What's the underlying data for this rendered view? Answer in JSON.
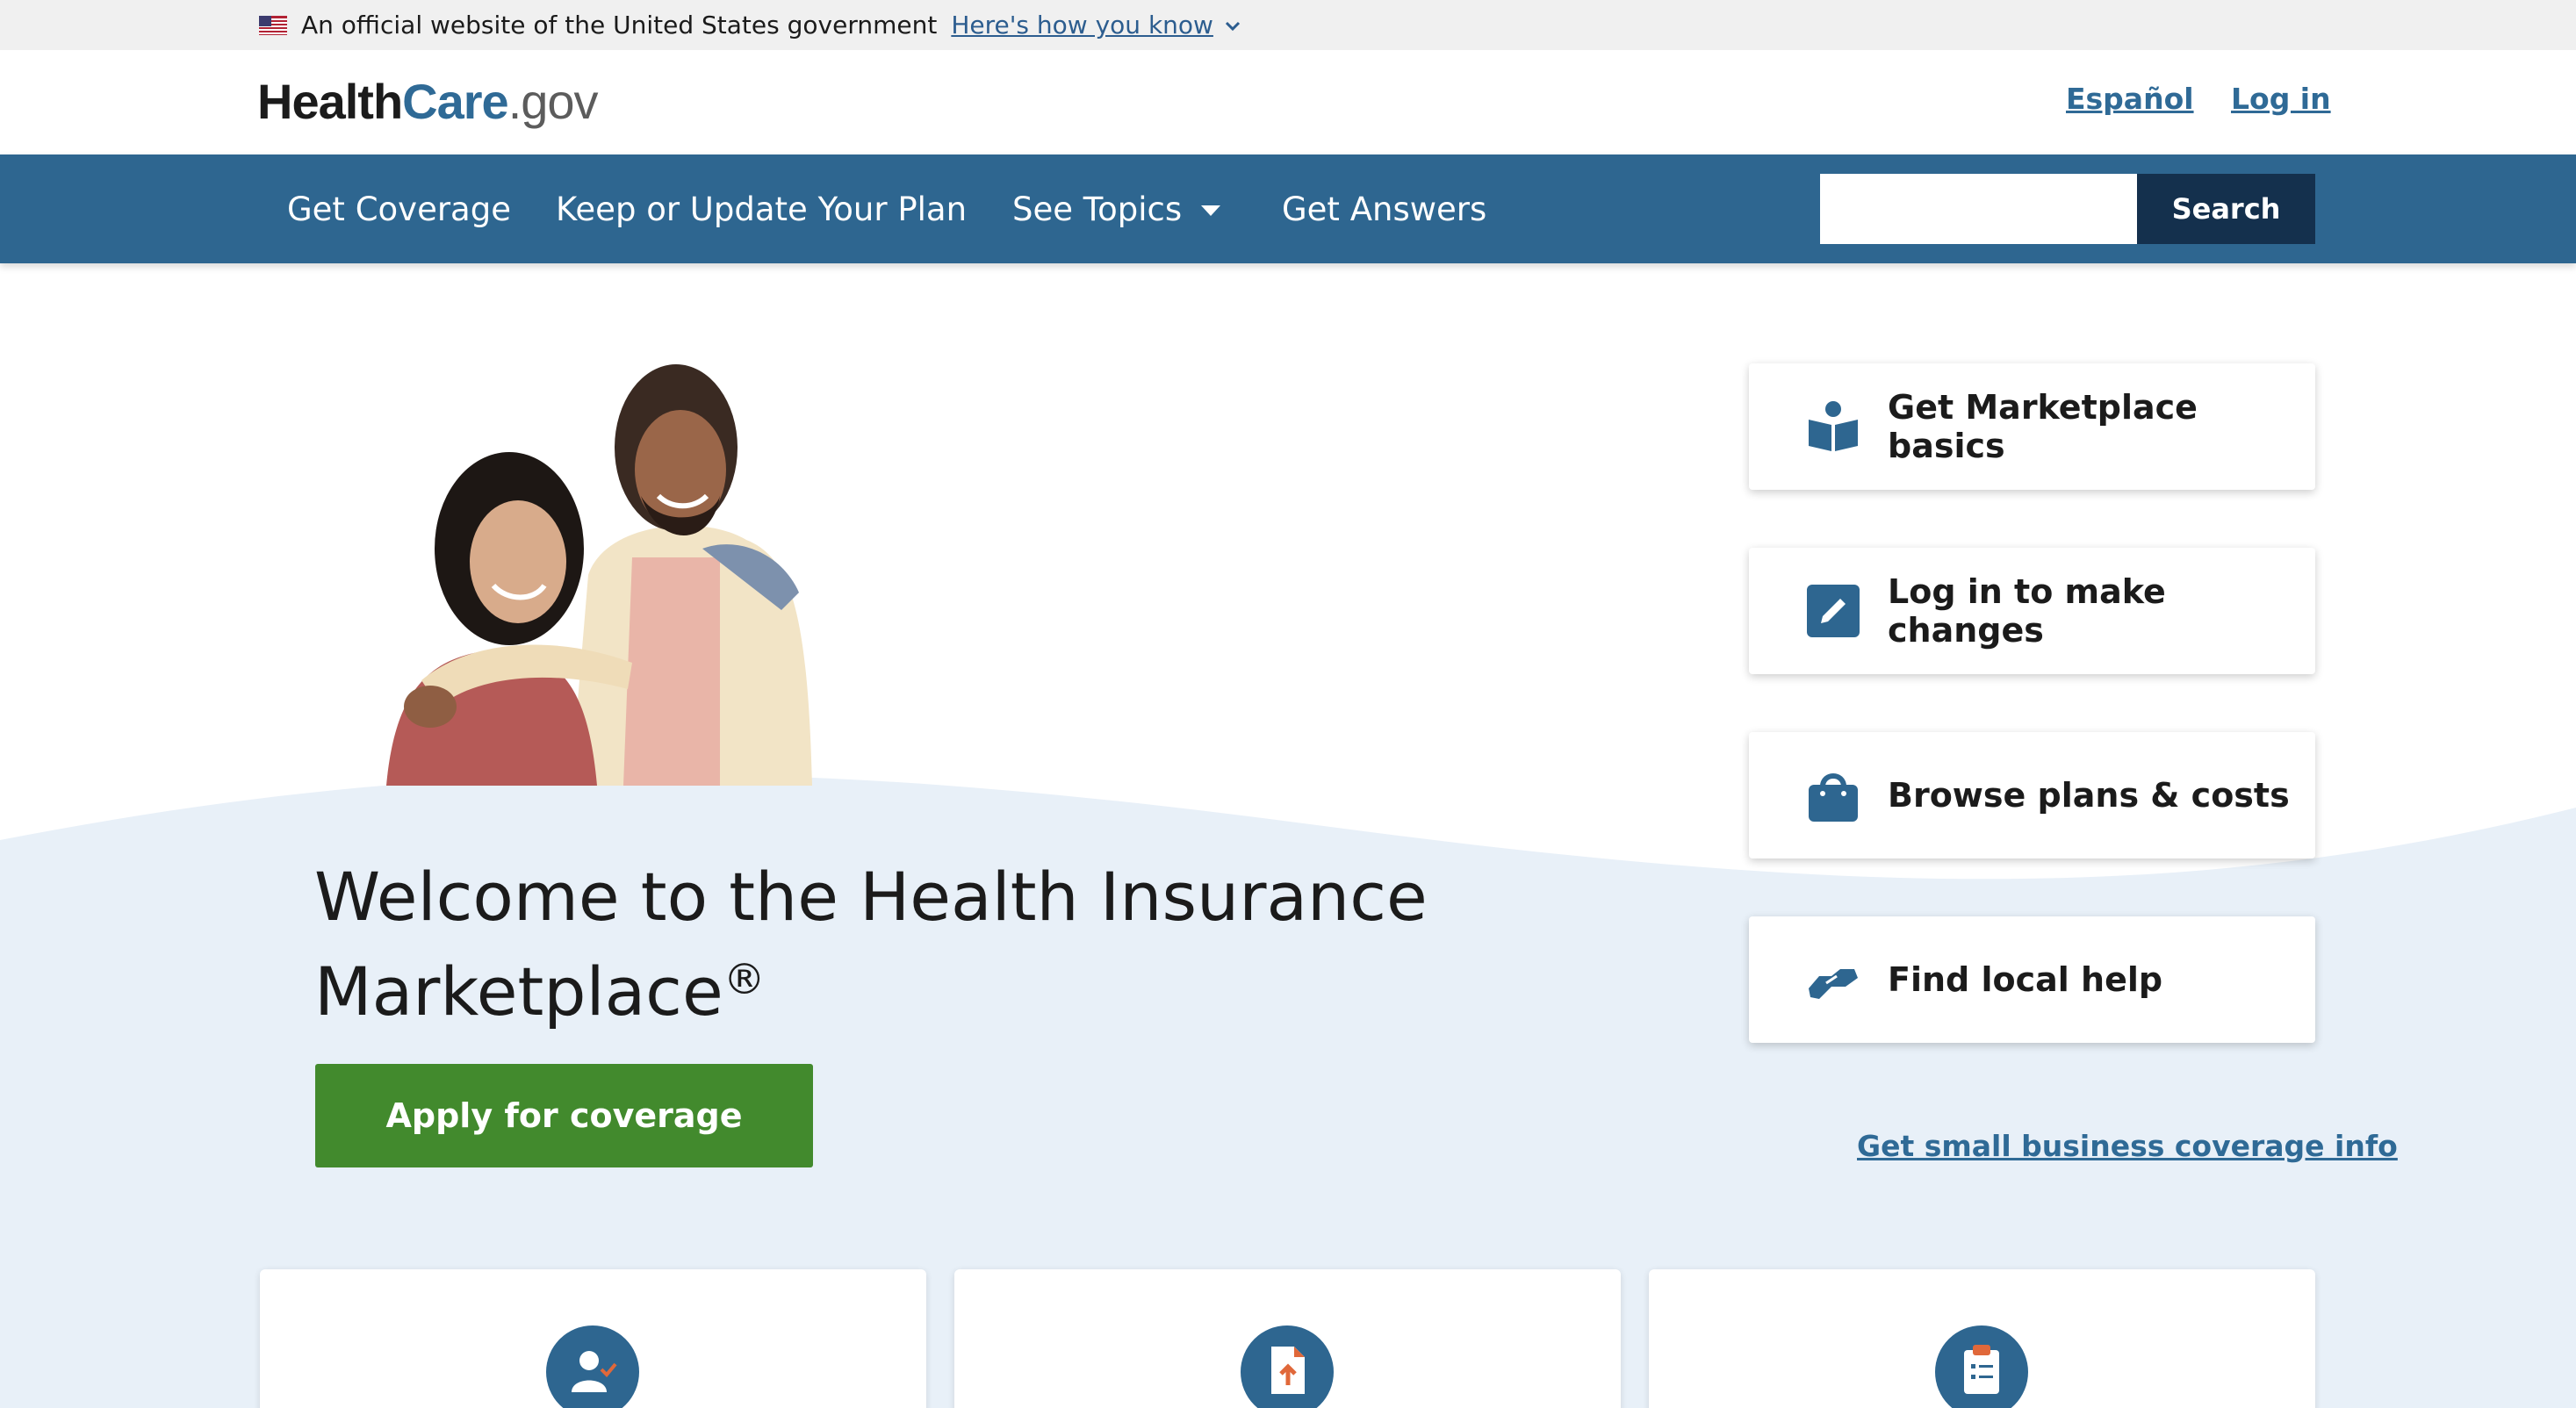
{
  "gov_banner": {
    "text": "An official website of the United States government",
    "link": "Here's how you know"
  },
  "header": {
    "logo": {
      "health": "Health",
      "care": "Care",
      "gov": ".gov"
    },
    "lang_link": "Español",
    "login_link": "Log in"
  },
  "nav": {
    "items": [
      {
        "label": "Get Coverage"
      },
      {
        "label": "Keep or Update Your Plan"
      },
      {
        "label": "See Topics"
      },
      {
        "label": "Get Answers"
      }
    ],
    "search_label": "Search",
    "search_value": ""
  },
  "hero": {
    "title": "Welcome to the Health Insurance Marketplace",
    "title_mark": "®",
    "apply_button": "Apply for coverage"
  },
  "action_cards": [
    {
      "label": "Get Marketplace basics",
      "icon": "book-reader-icon"
    },
    {
      "label": "Log in to make changes",
      "icon": "pencil-edit-icon"
    },
    {
      "label": "Browse plans & costs",
      "icon": "shopping-bag-icon"
    },
    {
      "label": "Find local help",
      "icon": "handshake-icon"
    }
  ],
  "small_business_link": "Get small business coverage info",
  "bottom_cards": [
    {
      "icon": "person-check-icon"
    },
    {
      "icon": "document-upload-icon"
    },
    {
      "icon": "clipboard-list-icon"
    }
  ],
  "colors": {
    "nav_bg": "#2e6690",
    "link": "#2f6a96",
    "apply_green": "#428a2d",
    "hero_bg": "#e8f0f8",
    "accent_orange": "#e0683a",
    "search_btn": "#14304d"
  }
}
